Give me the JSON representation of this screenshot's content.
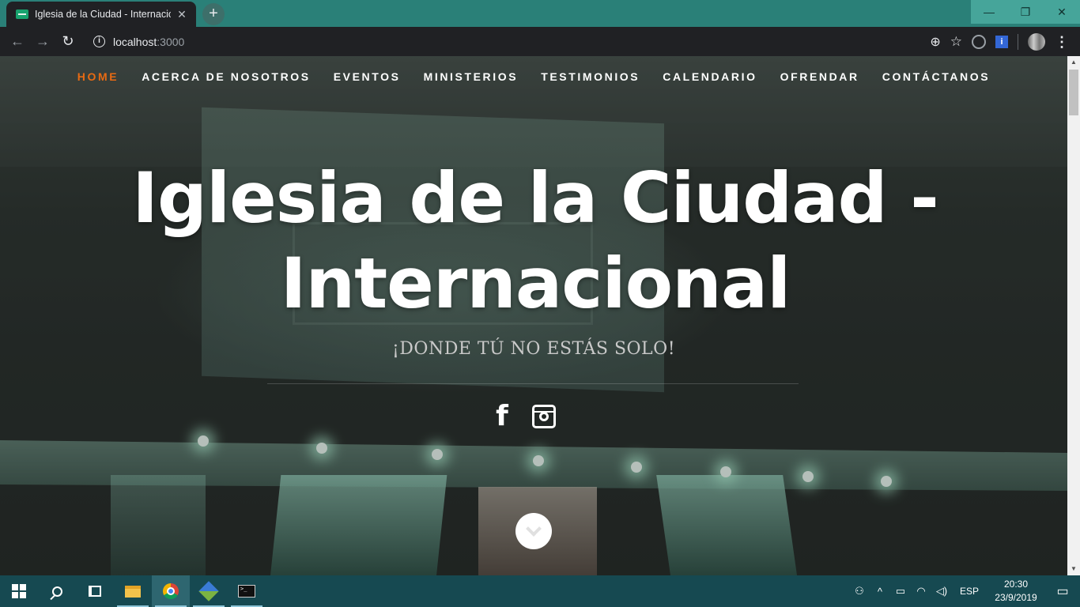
{
  "browser": {
    "tab_title": "Iglesia de la Ciudad - Internacional",
    "tab_close": "✕",
    "new_tab": "+",
    "url_host": "localhost",
    "url_port": ":3000",
    "window_controls": {
      "minimize": "—",
      "restore": "❐",
      "close": "✕"
    },
    "nav": {
      "back": "←",
      "forward": "→",
      "reload": "↻"
    },
    "zoom_icon": "⊕",
    "star_icon": "☆"
  },
  "site": {
    "nav": [
      {
        "label": "HOME",
        "active": true
      },
      {
        "label": "ACERCA DE NOSOTROS",
        "active": false
      },
      {
        "label": "EVENTOS",
        "active": false
      },
      {
        "label": "MINISTERIOS",
        "active": false
      },
      {
        "label": "TESTIMONIOS",
        "active": false
      },
      {
        "label": "CALENDARIO",
        "active": false
      },
      {
        "label": "OFRENDAR",
        "active": false
      },
      {
        "label": "CONTÁCTANOS",
        "active": false
      }
    ],
    "title_line1": "Iglesia de la Ciudad -",
    "title_line2": "Internacional",
    "subtitle": "¡DONDE TÚ NO ESTÁS SOLO!",
    "social": {
      "facebook": "f"
    },
    "accent_color": "#e86a13"
  },
  "taskbar": {
    "language": "ESP",
    "time": "20:30",
    "date": "23/9/2019"
  }
}
